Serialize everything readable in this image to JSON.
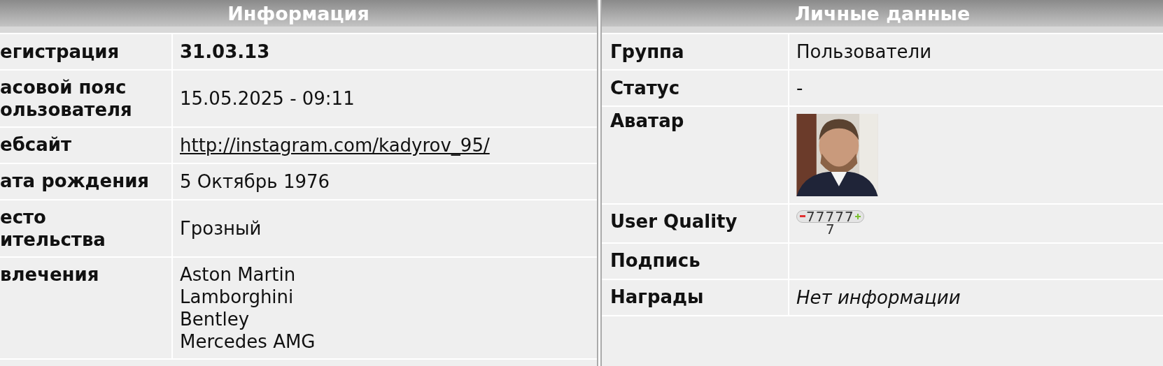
{
  "panels": [
    {
      "title": "Информация",
      "rows": [
        {
          "kind": "bold",
          "label": [
            "егистрация"
          ],
          "value": "31.03.13"
        },
        {
          "kind": "text",
          "label": [
            "асовой пояс",
            "ользователя"
          ],
          "value": "15.05.2025 - 09:11"
        },
        {
          "kind": "link",
          "label": [
            "ебсайт"
          ],
          "value": "http://instagram.com/kadyrov_95/"
        },
        {
          "kind": "text",
          "label": [
            "ата рождения"
          ],
          "value": "5 Октябрь 1976"
        },
        {
          "kind": "text",
          "label": [
            "есто",
            "ительства"
          ],
          "value": "Грозный"
        },
        {
          "kind": "list",
          "label": [
            "влечения"
          ],
          "values": [
            "Aston Martin",
            "Lamborghini",
            "Bentley",
            "Mercedes AMG"
          ]
        }
      ]
    },
    {
      "title": "Личные данные",
      "rows": [
        {
          "kind": "text",
          "label": [
            "Группа"
          ],
          "value": "Пользователи"
        },
        {
          "kind": "text",
          "label": [
            "Статус"
          ],
          "value": "-"
        },
        {
          "kind": "avatar",
          "label": [
            "Аватар"
          ]
        },
        {
          "kind": "rating",
          "label": [
            "User Quality"
          ],
          "value": "77777",
          "sub": "7"
        },
        {
          "kind": "empty",
          "label": [
            "Подпись"
          ]
        },
        {
          "kind": "italic",
          "label": [
            "Награды"
          ],
          "value": "Нет информации"
        }
      ]
    }
  ]
}
